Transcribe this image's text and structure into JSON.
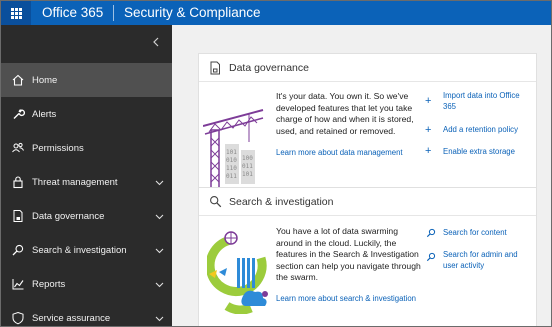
{
  "header": {
    "app_name": "Office 365",
    "product": "Security & Compliance",
    "waffle_icon": "app-launcher-icon",
    "bar_color": "#0b62b8"
  },
  "sidebar": {
    "collapse_icon": "chevron-left-icon",
    "items": [
      {
        "label": "Home",
        "icon": "home-icon",
        "active": true
      },
      {
        "label": "Alerts",
        "icon": "wrench-icon"
      },
      {
        "label": "Permissions",
        "icon": "people-icon"
      },
      {
        "label": "Threat management",
        "icon": "lock-icon",
        "expandable": true
      },
      {
        "label": "Data governance",
        "icon": "document-lock-icon",
        "expandable": true
      },
      {
        "label": "Search & investigation",
        "icon": "search-icon",
        "expandable": true
      },
      {
        "label": "Reports",
        "icon": "chart-icon",
        "expandable": true
      },
      {
        "label": "Service assurance",
        "icon": "shield-icon",
        "expandable": true
      }
    ]
  },
  "cards": {
    "data_governance": {
      "title": "Data governance",
      "description_lines": [
        "It's your data. You own it. So we've",
        "developed features that let you take",
        "charge of how and when it is stored,",
        "used, and retained or removed."
      ],
      "learn_more": "Learn more about data management",
      "actions": [
        {
          "lines": [
            "Import data into Office",
            "365"
          ]
        },
        {
          "lines": [
            "Add a retention policy"
          ]
        },
        {
          "lines": [
            "Enable extra storage"
          ]
        }
      ]
    },
    "search": {
      "title": "Search & investigation",
      "description_lines": [
        "You have a lot of data swarming",
        "around in the cloud. Luckily, the",
        "features in the Search & Investigation",
        "section can help you navigate through",
        "the swarm."
      ],
      "learn_more": "Learn more about search & investigation",
      "actions": [
        {
          "lines": [
            "Search for content"
          ]
        },
        {
          "lines": [
            "Search for admin and",
            "user activity"
          ]
        }
      ]
    }
  }
}
